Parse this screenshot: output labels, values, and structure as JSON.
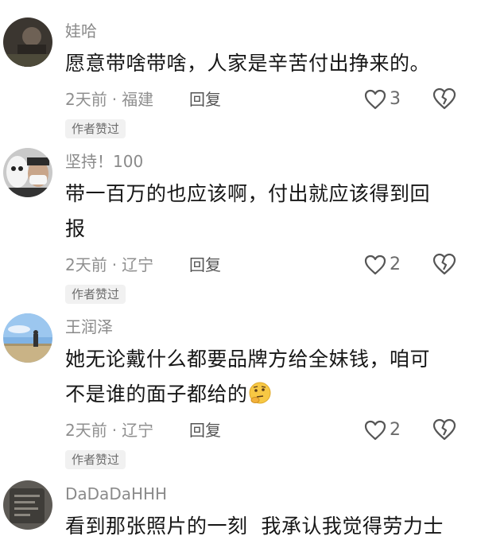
{
  "comments": [
    {
      "username": "娃哈",
      "text": "愿意带啥带啥，人家是辛苦付出挣来的。",
      "time": "2天前",
      "location": "福建",
      "reply_label": "回复",
      "likes": "3",
      "badge": "作者赞过"
    },
    {
      "username": "坚持！100",
      "text_line1": "带一百万的也应该啊，付出就应该得到回",
      "text_line2": "报",
      "time": "2天前",
      "location": "辽宁",
      "reply_label": "回复",
      "likes": "2",
      "badge": "作者赞过"
    },
    {
      "username": "王润泽",
      "text_line1": "她无论戴什么都要品牌方给全妹钱，咱可",
      "text_line2": "不是谁的面子都给的",
      "time": "2天前",
      "location": "辽宁",
      "reply_label": "回复",
      "likes": "2",
      "badge": "作者赞过"
    },
    {
      "username": "DaDaDaHHH",
      "text": "看到那张照片的一刻  我承认我觉得劳力士"
    }
  ],
  "separator": "·",
  "icons": {
    "like": "heart-outline-icon",
    "dislike": "broken-heart-outline-icon",
    "emoji": "thinking-face-emoji"
  },
  "colors": {
    "username": "#8a8a8a",
    "meta": "#8f8f8f",
    "badge_bg": "#f1f1f1"
  }
}
